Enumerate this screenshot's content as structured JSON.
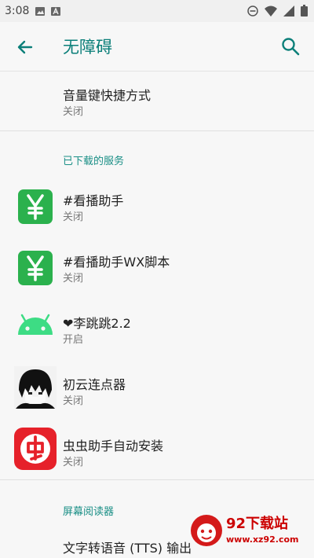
{
  "status_bar": {
    "time": "3:08"
  },
  "toolbar": {
    "title": "无障碍"
  },
  "shortcut": {
    "title": "音量键快捷方式",
    "status": "关闭"
  },
  "downloaded_services": {
    "header": "已下载的服务",
    "items": [
      {
        "name": "#看播助手",
        "status": "关闭",
        "icon": "yen-app-icon"
      },
      {
        "name": "#看播助手WX脚本",
        "status": "关闭",
        "icon": "yen-app-icon"
      },
      {
        "name": "❤李跳跳2.2",
        "status": "开启",
        "icon": "android-robot-icon"
      },
      {
        "name": "初云连点器",
        "status": "关闭",
        "icon": "anime-avatar-icon"
      },
      {
        "name": "虫虫助手自动安装",
        "status": "关闭",
        "icon": "chongchong-icon"
      }
    ]
  },
  "screen_reader": {
    "header": "屏幕阅读器",
    "tts_label": "文字转语音 (TTS) 输出"
  },
  "watermark": {
    "text": "92下载站",
    "url": "www.xz92.com"
  },
  "colors": {
    "accent": "#0b7f79",
    "section": "#1a8f86",
    "green_app": "#2bb14d",
    "red_app": "#e6212a"
  }
}
